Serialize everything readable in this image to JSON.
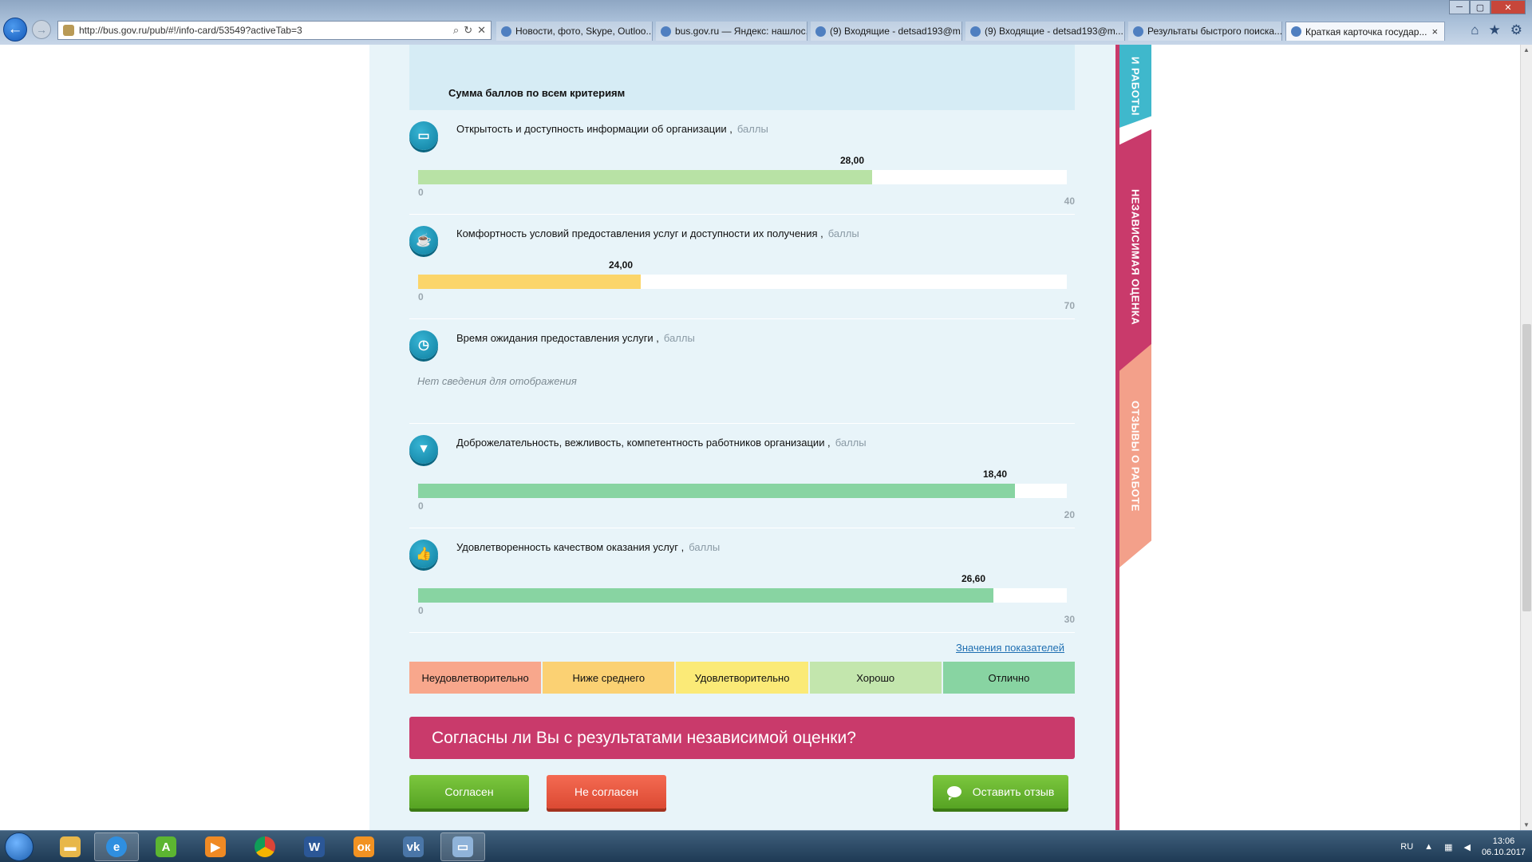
{
  "browser": {
    "url": "http://bus.gov.ru/pub/#!/info-card/53549?activeTab=3",
    "tabs": [
      {
        "label": "Новости, фото, Skype, Outloo..."
      },
      {
        "label": "bus.gov.ru — Яндекс: нашлос..."
      },
      {
        "label": "(9) Входящие - detsad193@m..."
      },
      {
        "label": "(9) Входящие - detsad193@m..."
      },
      {
        "label": "Результаты быстрого поиска..."
      },
      {
        "label": "Краткая карточка государ..."
      }
    ]
  },
  "section": {
    "header": "Сумма баллов по всем критериям",
    "unit_label": "баллы",
    "criteria": [
      {
        "title": "Открытость и доступность информации об организации ,",
        "value_label": "28,00",
        "value": 28,
        "min_label": "0",
        "max_label": "40",
        "max": 40,
        "color": "#b8e2a5",
        "icon": "monitor-icon",
        "icon_glyph": "▭"
      },
      {
        "title": "Комфортность условий предоставления услуг и доступности их получения ,",
        "value_label": "24,00",
        "value": 24,
        "min_label": "0",
        "max_label": "70",
        "max": 70,
        "color": "#fbd56a",
        "icon": "cup-icon",
        "icon_glyph": "☕"
      },
      {
        "title": "Время ожидания предоставления услуги ,",
        "no_data": "Нет сведения для отображения",
        "icon": "clock-icon",
        "icon_glyph": "◷"
      },
      {
        "title": "Доброжелательность, вежливость, компетентность работников организации ,",
        "value_label": "18,40",
        "value": 18.4,
        "min_label": "0",
        "max_label": "20",
        "max": 20,
        "color": "#88d4a2",
        "icon": "tie-icon",
        "icon_glyph": "▼"
      },
      {
        "title": "Удовлетворенность качеством оказания услуг ,",
        "value_label": "26,60",
        "value": 26.6,
        "min_label": "0",
        "max_label": "30",
        "max": 30,
        "color": "#88d4a2",
        "icon": "thumbs-up-icon",
        "icon_glyph": "👍"
      }
    ]
  },
  "scale": {
    "link_label": "Значения показателей",
    "levels": [
      {
        "label": "Неудовлетворительно",
        "color": "#f8a78c"
      },
      {
        "label": "Ниже среднего",
        "color": "#fbd173"
      },
      {
        "label": "Удовлетворительно",
        "color": "#fbea77"
      },
      {
        "label": "Хорошо",
        "color": "#c3e6ad"
      },
      {
        "label": "Отлично",
        "color": "#88d4a2"
      }
    ]
  },
  "agreement": {
    "question": "Согласны ли Вы с результатами независимой оценки?",
    "agree_label": "Согласен",
    "disagree_label": "Не согласен",
    "review_label": "Оставить отзыв"
  },
  "side_tabs": {
    "work": "И РАБОТЫ",
    "independent": "НЕЗАВИСИМАЯ ОЦЕНКА",
    "reviews": "ОТЗЫВЫ О РАБОТЕ"
  },
  "taskbar": {
    "lang": "RU",
    "time": "13:06",
    "date": "06.10.2017"
  }
}
